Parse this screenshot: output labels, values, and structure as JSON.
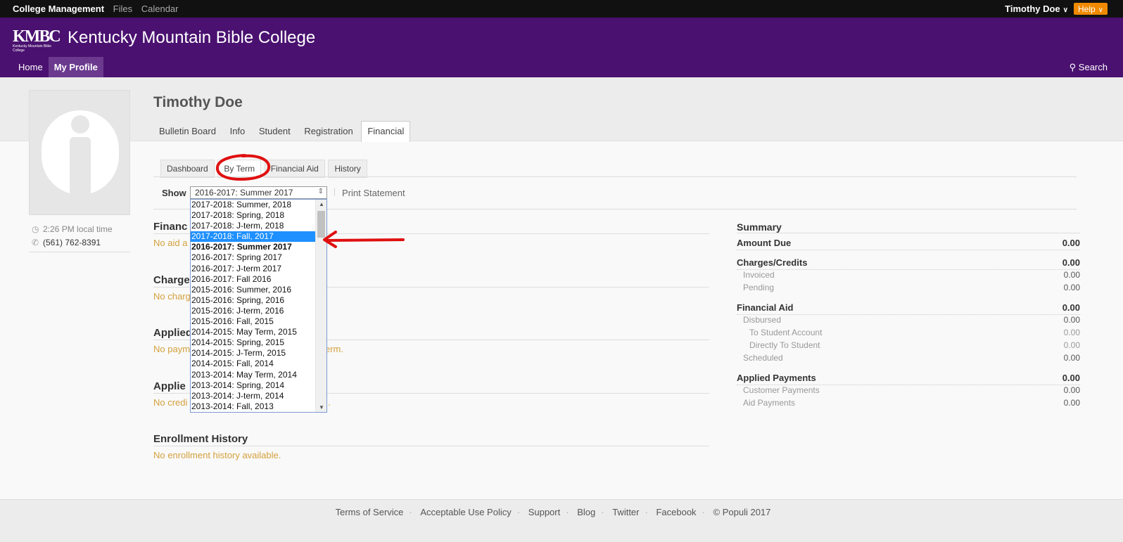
{
  "topbar": {
    "apps": [
      "College Management",
      "Files",
      "Calendar"
    ],
    "user": "Timothy Doe",
    "help": "Help"
  },
  "header": {
    "logo_text": "KMBC",
    "logo_sub": "Kentucky Mountain Bible College",
    "school_name": "Kentucky Mountain Bible College",
    "nav": [
      "Home",
      "My Profile"
    ],
    "search": "Search"
  },
  "profile": {
    "name": "Timothy Doe",
    "local_time": "2:26 PM local time",
    "phone": "(561) 762-8391",
    "tabs": [
      "Bulletin Board",
      "Info",
      "Student",
      "Registration",
      "Financial"
    ]
  },
  "financial": {
    "subtabs": [
      "Dashboard",
      "By Term",
      "Financial Aid",
      "History"
    ],
    "show_label": "Show",
    "selected_term": "2016-2017: Summer 2017",
    "print_statement": "Print Statement",
    "term_options": [
      "2017-2018: Summer, 2018",
      "2017-2018: Spring, 2018",
      "2017-2018: J-term, 2018",
      "2017-2018: Fall, 2017",
      "2016-2017: Summer 2017",
      "2016-2017: Spring 2017",
      "2016-2017: J-term 2017",
      "2016-2017: Fall 2016",
      "2015-2016: Summer, 2016",
      "2015-2016: Spring, 2016",
      "2015-2016: J-term, 2016",
      "2015-2016: Fall, 2015",
      "2014-2015: May Term, 2015",
      "2014-2015: Spring, 2015",
      "2014-2015: J-Term, 2015",
      "2014-2015: Fall, 2014",
      "2013-2014: May Term, 2014",
      "2013-2014: Spring, 2014",
      "2013-2014: J-term, 2014",
      "2013-2014: Fall, 2013"
    ],
    "sections": {
      "aid_title": "Financ",
      "aid_msg": "No aid a",
      "charges_title": "Charge",
      "charges_msg": "No charg",
      "payments_title": "Applied",
      "payments_msg_left": "No paym",
      "payments_msg_right": "erm.",
      "credits_title": "Applie",
      "credits_msg_left": "No credi",
      "credits_msg_right": ".",
      "enrollment_title": "Enrollment History",
      "enrollment_msg": "No enrollment history available."
    }
  },
  "summary": {
    "title": "Summary",
    "amount_due": {
      "label": "Amount Due",
      "value": "0.00"
    },
    "charges_credits": {
      "label": "Charges/Credits",
      "value": "0.00"
    },
    "invoiced": {
      "label": "Invoiced",
      "value": "0.00"
    },
    "pending": {
      "label": "Pending",
      "value": "0.00"
    },
    "financial_aid": {
      "label": "Financial Aid",
      "value": "0.00"
    },
    "disbursed": {
      "label": "Disbursed",
      "value": "0.00"
    },
    "to_student_account": {
      "label": "To Student Account",
      "value": "0.00"
    },
    "directly_to_student": {
      "label": "Directly To Student",
      "value": "0.00"
    },
    "scheduled": {
      "label": "Scheduled",
      "value": "0.00"
    },
    "applied_payments": {
      "label": "Applied Payments",
      "value": "0.00"
    },
    "customer_payments": {
      "label": "Customer Payments",
      "value": "0.00"
    },
    "aid_payments": {
      "label": "Aid Payments",
      "value": "0.00"
    }
  },
  "footer": {
    "links": [
      "Terms of Service",
      "Acceptable Use Policy",
      "Support",
      "Blog",
      "Twitter",
      "Facebook",
      "© Populi 2017"
    ]
  },
  "colors": {
    "header_purple": "#4a1170",
    "help_orange": "#f08a00",
    "empty_text": "#d4a03c",
    "highlight_blue": "#1e90ff",
    "annotation_red": "#e01010"
  }
}
